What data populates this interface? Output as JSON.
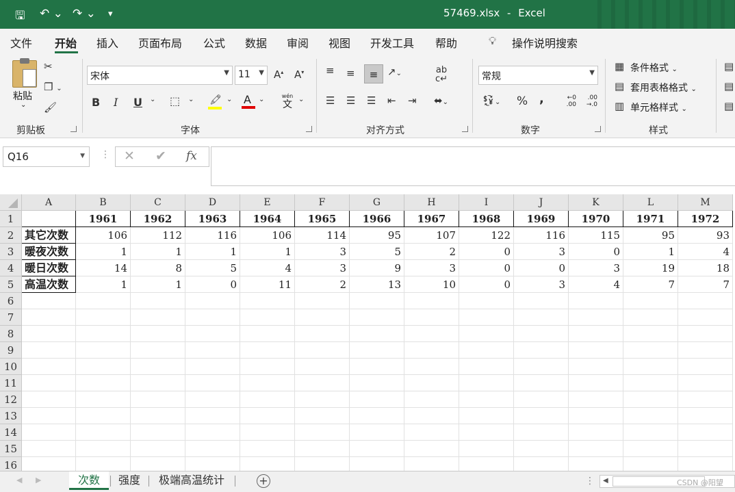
{
  "titlebar": {
    "filename": "57469.xlsx",
    "separator": "-",
    "app": "Excel",
    "undo_icon": "undo-icon",
    "redo_icon": "redo-icon",
    "save_icon": "save-icon"
  },
  "menu": {
    "items": [
      "文件",
      "开始",
      "插入",
      "页面布局",
      "公式",
      "数据",
      "审阅",
      "视图",
      "开发工具",
      "帮助"
    ],
    "active": "开始",
    "search": "操作说明搜索",
    "accent": "#217346"
  },
  "ribbon": {
    "paste_label": "粘贴",
    "font_name": "宋体",
    "font_size": "11",
    "number_format": "常规",
    "conditional_format": "条件格式",
    "table_format": "套用表格格式",
    "cell_styles": "单元格样式",
    "group_clipboard": "剪贴板",
    "group_font": "字体",
    "group_alignment": "对齐方式",
    "group_number": "数字",
    "group_styles": "样式",
    "bold": "B",
    "italic": "I",
    "underline": "U",
    "percent": "%",
    "comma": ",",
    "wen": "wén",
    "wen_char": "文",
    "inc_dec": ".00",
    "dec_dec": ".0"
  },
  "formula": {
    "name_box": "Q16",
    "fx": "fx",
    "content": ""
  },
  "columns": [
    "A",
    "B",
    "C",
    "D",
    "E",
    "F",
    "G",
    "H",
    "I",
    "J",
    "K",
    "L",
    "M"
  ],
  "rows": [
    "1",
    "2",
    "3",
    "4",
    "5",
    "6",
    "7",
    "8",
    "9",
    "10",
    "11",
    "12",
    "13",
    "14",
    "15",
    "16"
  ],
  "table": {
    "years": [
      "1961",
      "1962",
      "1963",
      "1964",
      "1965",
      "1966",
      "1967",
      "1968",
      "1969",
      "1970",
      "1971",
      "1972"
    ],
    "rows": [
      {
        "label": "其它次数",
        "values": [
          "106",
          "112",
          "116",
          "106",
          "114",
          "95",
          "107",
          "122",
          "116",
          "115",
          "95",
          "93"
        ]
      },
      {
        "label": "暖夜次数",
        "values": [
          "1",
          "1",
          "1",
          "1",
          "3",
          "5",
          "2",
          "0",
          "3",
          "0",
          "1",
          "4"
        ]
      },
      {
        "label": "暖日次数",
        "values": [
          "14",
          "8",
          "5",
          "4",
          "3",
          "9",
          "3",
          "0",
          "0",
          "3",
          "19",
          "18"
        ]
      },
      {
        "label": "高温次数",
        "values": [
          "1",
          "1",
          "0",
          "11",
          "2",
          "13",
          "10",
          "0",
          "3",
          "4",
          "7",
          "7"
        ]
      }
    ]
  },
  "sheets": {
    "tabs": [
      "次数",
      "强度",
      "极端高温统计"
    ],
    "active": "次数"
  },
  "watermark": "CSDN @阳望"
}
